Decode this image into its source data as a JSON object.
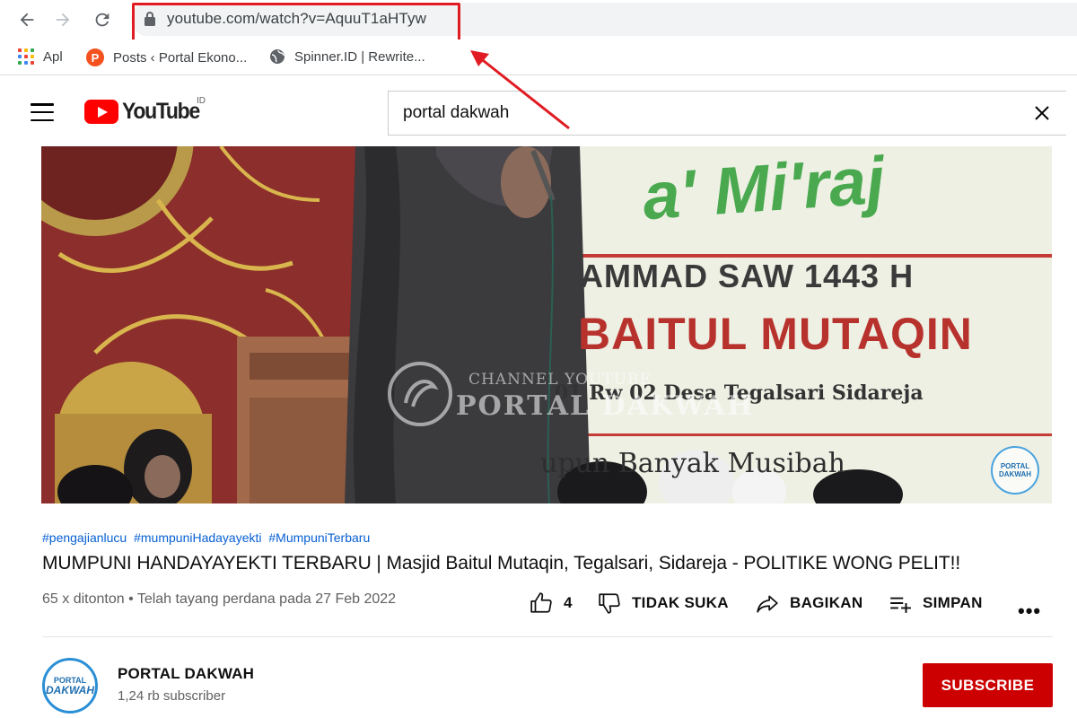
{
  "browser": {
    "url": "youtube.com/watch?v=AquuT1aHTyw",
    "bookmarks": [
      {
        "label": "Apl",
        "icon": "apps-grid-icon"
      },
      {
        "label": "Posts ‹ Portal Ekono...",
        "icon": "p-logo-icon"
      },
      {
        "label": "Spinner.ID | Rewrite...",
        "icon": "globe-icon"
      }
    ]
  },
  "header": {
    "logo_text": "YouTube",
    "country_code": "ID",
    "search_value": "portal dakwah"
  },
  "video_overlay": {
    "banner_line1": "a' Mi'raj",
    "banner_line2": "AMMAD SAW 1443 H",
    "banner_line3": "BAITUL MUTAQIN",
    "banner_line4": "01 Rw 02 Desa Tegalsari Sidareja",
    "banner_line5": "upun Banyak Musibah",
    "watermark_line1": "CHANNEL YOUTUBE",
    "watermark_line2": "PORTAL DAKWAH",
    "corner_logo_line1": "PORTAL",
    "corner_logo_line2": "DAKWAH"
  },
  "video_info": {
    "hashtags": [
      "#pengajianlucu",
      "#mumpuniHadayayekti",
      "#MumpuniTerbaru"
    ],
    "title": "MUMPUNI HANDAYAYEKTI TERBARU | Masjid Baitul Mutaqin, Tegalsari, Sidareja - POLITIKE WONG PELIT!!",
    "meta": "65 x ditonton • Telah tayang perdana pada 27 Feb 2022"
  },
  "actions": {
    "like_count": "4",
    "dislike_label": "TIDAK SUKA",
    "share_label": "BAGIKAN",
    "save_label": "SIMPAN",
    "more_label": "•••"
  },
  "channel": {
    "name": "PORTAL DAKWAH",
    "subscribers": "1,24 rb subscriber",
    "avatar_line1": "PORTAL",
    "avatar_line2": "DAKWAH",
    "subscribe_label": "SUBSCRIBE"
  },
  "colors": {
    "highlight_red": "#e01b22",
    "youtube_red": "#ff0000",
    "subscribe_red": "#cc0000",
    "link_blue": "#065fd4"
  }
}
